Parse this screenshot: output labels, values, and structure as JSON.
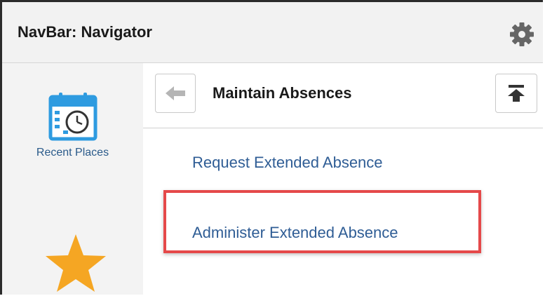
{
  "header": {
    "title": "NavBar: Navigator",
    "settings_icon": "gear-icon"
  },
  "sidebar": {
    "items": [
      {
        "label": "Recent Places",
        "icon": "calendar-clock-icon"
      },
      {
        "label": "",
        "icon": "star-icon"
      }
    ]
  },
  "panel": {
    "title": "Maintain Absences",
    "back_icon": "back-arrow-icon",
    "top_icon": "scroll-top-icon",
    "links": [
      {
        "label": "Request Extended Absence"
      },
      {
        "label": "Administer Extended Absence",
        "highlighted": true
      }
    ]
  },
  "colors": {
    "link": "#2f5d95",
    "highlight_border": "#e5494a",
    "calendar_blue": "#2e9be0",
    "star": "#f5a623"
  }
}
